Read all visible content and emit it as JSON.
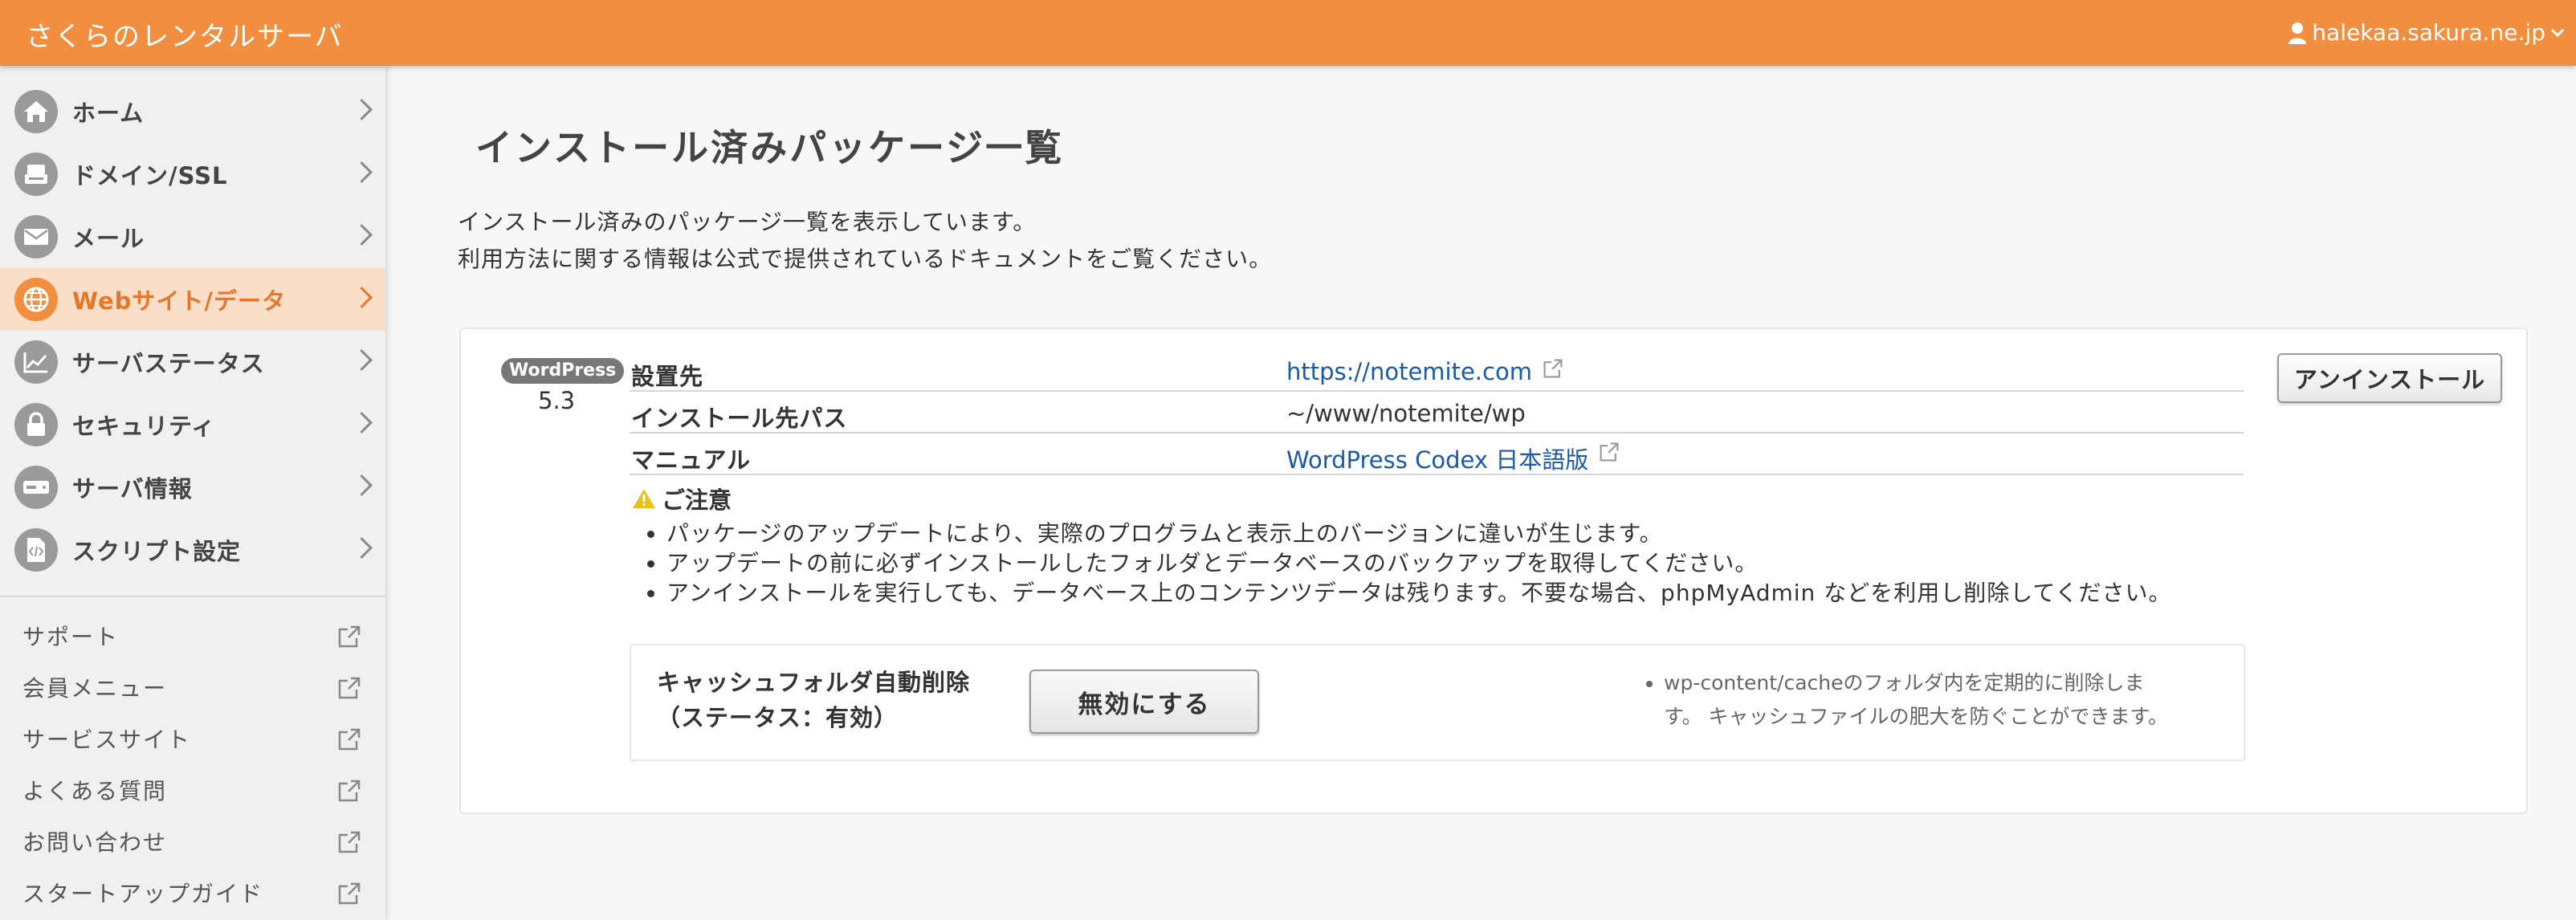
{
  "header": {
    "brand": "さくらのレンタルサーバ",
    "user": "halekaa.sakura.ne.jp"
  },
  "sidebar": {
    "nav": [
      {
        "label": "ホーム",
        "icon": "home-icon"
      },
      {
        "label": "ドメイン/SSL",
        "icon": "domain-icon"
      },
      {
        "label": "メール",
        "icon": "mail-icon"
      },
      {
        "label": "Webサイト/データ",
        "icon": "globe-icon",
        "active": true
      },
      {
        "label": "サーバステータス",
        "icon": "chart-icon"
      },
      {
        "label": "セキュリティ",
        "icon": "lock-icon"
      },
      {
        "label": "サーバ情報",
        "icon": "server-icon"
      },
      {
        "label": "スクリプト設定",
        "icon": "script-icon"
      }
    ],
    "links": [
      {
        "label": "サポート"
      },
      {
        "label": "会員メニュー"
      },
      {
        "label": "サービスサイト"
      },
      {
        "label": "よくある質問"
      },
      {
        "label": "お問い合わせ"
      },
      {
        "label": "スタートアップガイド"
      }
    ]
  },
  "main": {
    "title": "インストール済みパッケージ一覧",
    "desc_line1": "インストール済みのパッケージ一覧を表示しています。",
    "desc_line2": "利用方法に関する情報は公式で提供されているドキュメントをご覧ください。",
    "package": {
      "badge": "WordPress",
      "version": "5.3",
      "rows": [
        {
          "key": "設置先",
          "value": "https://notemite.com"
        },
        {
          "key": "インストール先パス",
          "value": "~/www/notemite/wp"
        },
        {
          "key": "マニュアル",
          "value": "WordPress Codex 日本語版"
        }
      ],
      "uninstall_label": "アンインストール",
      "notice_title": "ご注意",
      "notices": [
        "パッケージのアップデートにより、実際のプログラムと表示上のバージョンに違いが生じます。",
        "アップデートの前に必ずインストールしたフォルダとデータベースのバックアップを取得してください。",
        "アンインストールを実行しても、データベース上のコンテンツデータは残ります。不要な場合、phpMyAdmin などを利用し削除してください。"
      ],
      "cache": {
        "label_line1": "キャッシュフォルダ自動削除",
        "label_line2": "（ステータス：有効）",
        "button": "無効にする",
        "note_line1": "wp-content/cacheのフォルダ内を定期的に削除しま",
        "note_line2": "す。 キャッシュファイルの肥大を防ぐことができます。"
      }
    }
  },
  "colors": {
    "accent": "#f28e3f",
    "active_bg": "#fadfc8",
    "link": "#1a5aa8"
  }
}
